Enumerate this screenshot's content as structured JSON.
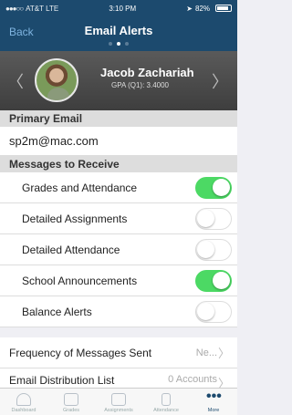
{
  "status_bar": {
    "carrier": "AT&T LTE",
    "time": "3:10 PM",
    "battery": "82%"
  },
  "nav": {
    "back_label": "Back",
    "title": "Email Alerts",
    "page_dots": 3,
    "active_dot": 1
  },
  "profile": {
    "name": "Jacob Zachariah",
    "gpa": "GPA (Q1): 3.4000"
  },
  "primary_email": {
    "header": "Primary Email",
    "value": "sp2m@mac.com"
  },
  "messages": {
    "header": "Messages to Receive",
    "items": [
      {
        "label": "Grades and Attendance",
        "on": true
      },
      {
        "label": "Detailed Assignments",
        "on": false
      },
      {
        "label": "Detailed Attendance",
        "on": false
      },
      {
        "label": "School Announcements",
        "on": true
      },
      {
        "label": "Balance Alerts",
        "on": false
      }
    ]
  },
  "frequency": {
    "label": "Frequency of Messages Sent",
    "value": "Ne..."
  },
  "distribution": {
    "label": "Email Distribution List",
    "value": "0 Accounts"
  },
  "tabs": [
    {
      "label": "Dashboard",
      "icon": "dashboard-icon"
    },
    {
      "label": "Grades",
      "icon": "grades-icon"
    },
    {
      "label": "Assignments",
      "icon": "assignments-icon"
    },
    {
      "label": "Attendance",
      "icon": "attendance-icon"
    },
    {
      "label": "More",
      "icon": "more-icon"
    }
  ],
  "colors": {
    "nav": "#1c4a6e",
    "toggle_on": "#4cd964"
  }
}
